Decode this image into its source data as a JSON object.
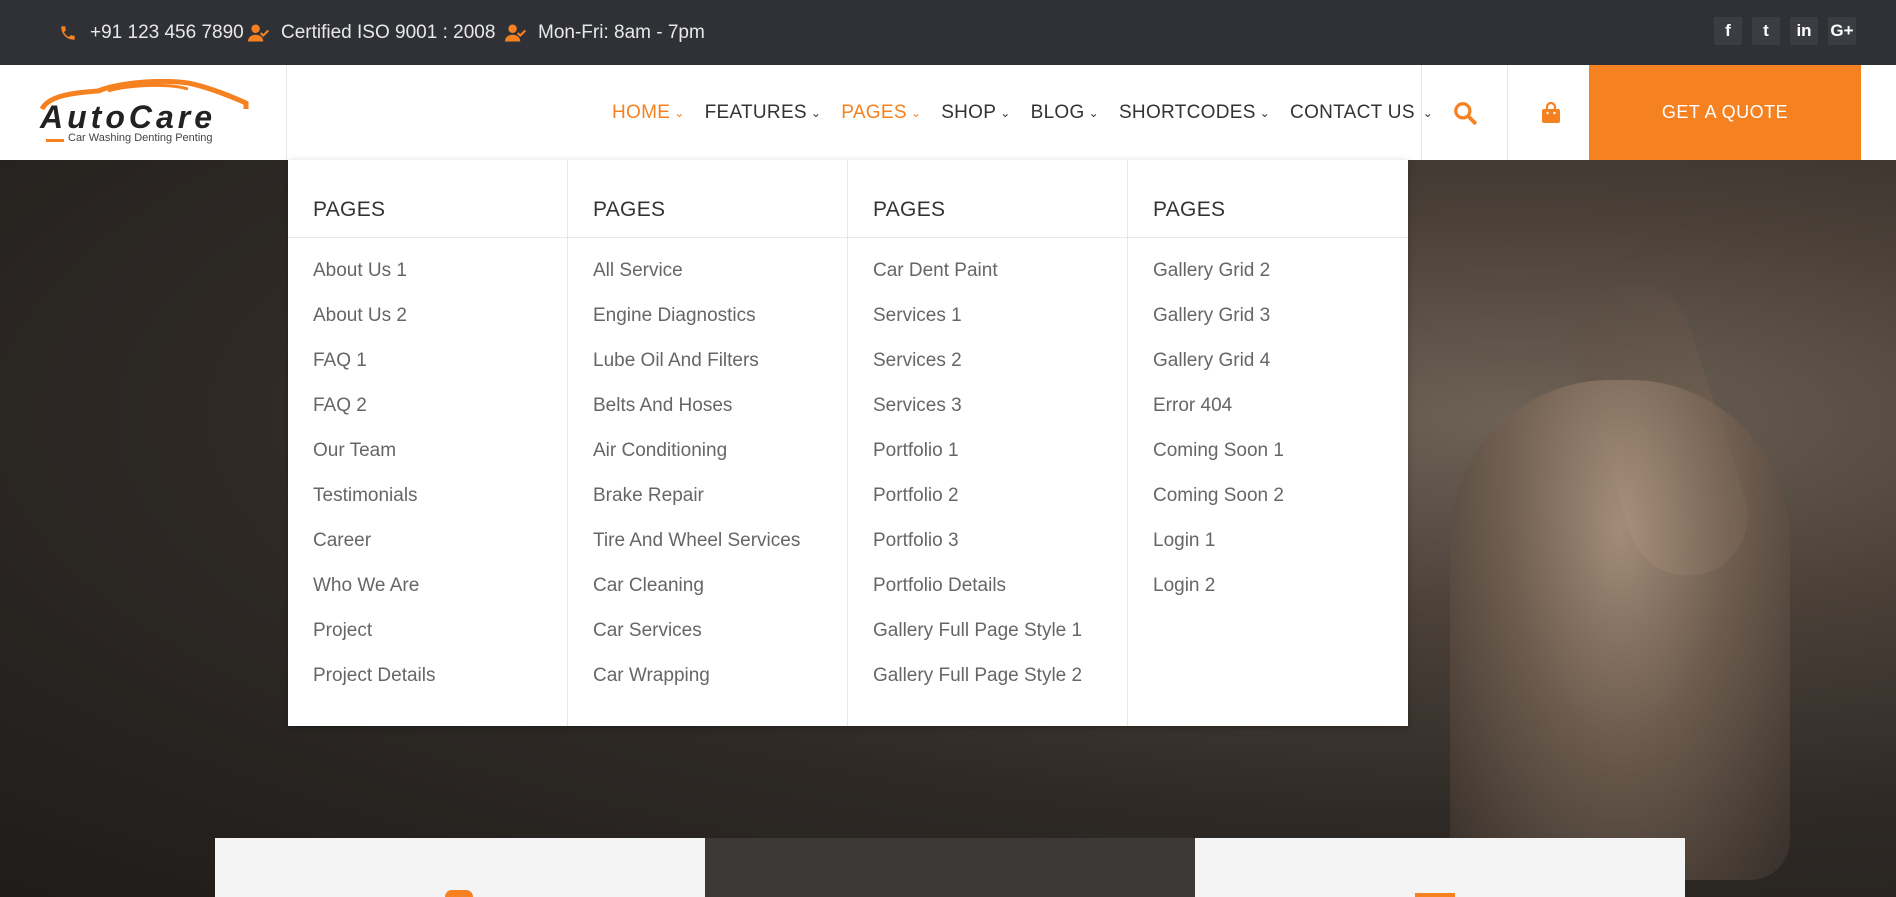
{
  "topbar": {
    "phone": "+91 123 456 7890",
    "certified": "Certified ISO 9001 : 2008",
    "hours": "Mon-Fri: 8am - 7pm",
    "social": [
      "f",
      "t",
      "in",
      "G+"
    ]
  },
  "logo": {
    "name": "AutoCare",
    "tagline": "Car Washing Denting Penting"
  },
  "nav": [
    {
      "label": "HOME",
      "active": true
    },
    {
      "label": "FEATURES",
      "active": false
    },
    {
      "label": "PAGES",
      "active": true
    },
    {
      "label": "SHOP",
      "active": false
    },
    {
      "label": "BLOG",
      "active": false
    },
    {
      "label": "SHORTCODES",
      "active": false
    },
    {
      "label": "CONTACT US",
      "active": false
    }
  ],
  "quote_button": "GET A QUOTE",
  "colors": {
    "accent": "#f68121",
    "topbar": "#2f3136",
    "menu_text": "#666666"
  },
  "mega_menu": [
    {
      "title": "PAGES",
      "items": [
        "About Us 1",
        "About Us 2",
        "FAQ 1",
        "FAQ 2",
        "Our Team",
        "Testimonials",
        "Career",
        "Who We Are",
        "Project",
        "Project Details"
      ]
    },
    {
      "title": "PAGES",
      "items": [
        "All Service",
        "Engine Diagnostics",
        "Lube Oil And Filters",
        "Belts And Hoses",
        "Air Conditioning",
        "Brake Repair",
        "Tire And Wheel Services",
        "Car Cleaning",
        "Car Services",
        "Car Wrapping"
      ]
    },
    {
      "title": "PAGES",
      "items": [
        "Car Dent Paint",
        "Services 1",
        "Services 2",
        "Services 3",
        "Portfolio 1",
        "Portfolio 2",
        "Portfolio 3",
        "Portfolio Details",
        "Gallery Full Page Style 1",
        "Gallery Full Page Style 2"
      ]
    },
    {
      "title": "PAGES",
      "items": [
        "Gallery Grid 2",
        "Gallery Grid 3",
        "Gallery Grid 4",
        "Error 404",
        "Coming Soon 1",
        "Coming Soon 2",
        "Login 1",
        "Login 2"
      ]
    }
  ]
}
